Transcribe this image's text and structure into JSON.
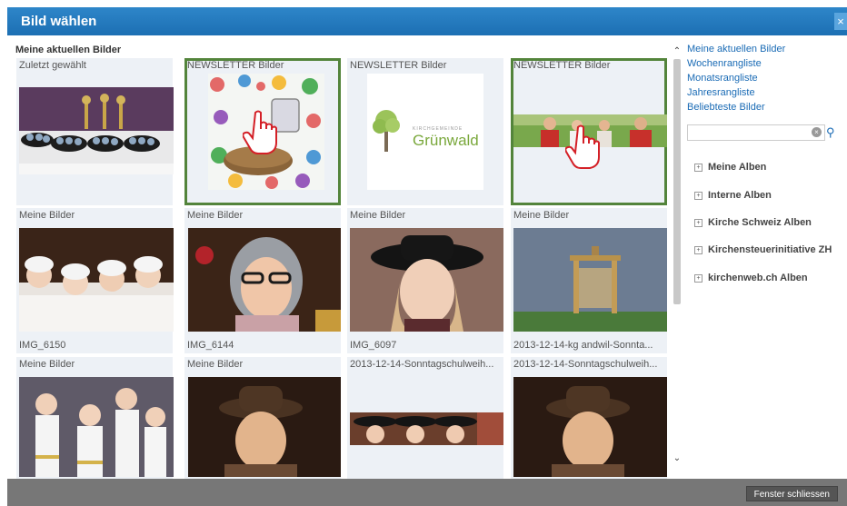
{
  "window": {
    "title": "Bild wählen",
    "close_symbol": "×"
  },
  "main": {
    "section_title": "Meine aktuellen Bilder",
    "rows": [
      {
        "tiles": [
          {
            "caption": "Zuletzt gewählt",
            "label": "",
            "selected": false
          },
          {
            "caption": "NEWSLETTER Bilder",
            "label": "",
            "selected": true
          },
          {
            "caption": "NEWSLETTER Bilder",
            "label": "",
            "selected": false
          },
          {
            "caption": "NEWSLETTER Bilder",
            "label": "",
            "selected": true
          }
        ]
      },
      {
        "tiles": [
          {
            "caption": "Meine Bilder",
            "label": "IMG_6150"
          },
          {
            "caption": "Meine Bilder",
            "label": "IMG_6144"
          },
          {
            "caption": "Meine Bilder",
            "label": "IMG_6097"
          },
          {
            "caption": "Meine Bilder",
            "label": "2013-12-14-kg andwil-Sonnta..."
          }
        ]
      },
      {
        "tiles": [
          {
            "caption": "Meine Bilder"
          },
          {
            "caption": "Meine Bilder"
          },
          {
            "caption": "2013-12-14-Sonntagschulweih..."
          },
          {
            "caption": "2013-12-14-Sonntagschulweih..."
          }
        ]
      }
    ],
    "logo": {
      "small_text": "KIRCHGEMEINDE",
      "name": "Grünwald"
    }
  },
  "sidebar": {
    "links": [
      "Meine aktuellen Bilder",
      "Wochenrangliste",
      "Monatsrangliste",
      "Jahresrangliste",
      "Beliebteste Bilder"
    ],
    "search": {
      "value": "",
      "placeholder": ""
    },
    "albums": [
      "Meine Alben",
      "Interne Alben",
      "Kirche Schweiz Alben",
      "Kirchensteuerinitiative ZH",
      "kirchenweb.ch Alben"
    ]
  },
  "footer": {
    "close_label": "Fenster schliessen"
  },
  "colors": {
    "titlebar": "#1f74b8",
    "selection": "#53843b",
    "link": "#1a6bb5",
    "footer": "#777777"
  }
}
